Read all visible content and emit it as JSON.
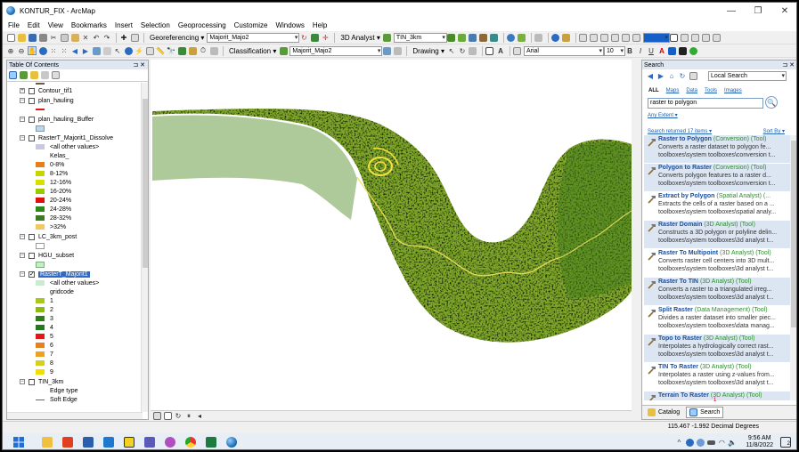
{
  "window": {
    "title": "KONTUR_FIX - ArcMap",
    "min": "—",
    "max": "❐",
    "close": "✕"
  },
  "menu": [
    "File",
    "Edit",
    "View",
    "Bookmarks",
    "Insert",
    "Selection",
    "Geoprocessing",
    "Customize",
    "Windows",
    "Help"
  ],
  "toolbar1": {
    "georef_label": "Georeferencing ▾",
    "georef_layer": "Majorit_Majo2",
    "analyst_label": "3D Analyst ▾",
    "analyst_layer": "TIN_3km",
    "fill_color": "#1560c8"
  },
  "toolbar2": {
    "classification_label": "Classification ▾",
    "classification_layer": "Majorit_Majo2",
    "drawing_label": "Drawing ▾",
    "font": "Arial",
    "font_size": "10",
    "bold": "B",
    "italic": "I",
    "underline": "U"
  },
  "toc": {
    "title": "Table Of Contents",
    "pin": "⊐ ✕",
    "items": [
      {
        "label": "Contour_tif1",
        "checked": false
      },
      {
        "label": "plan_hauling",
        "checked": false
      },
      {
        "label": "plan_hauling_Buffer",
        "checked": false
      },
      {
        "label": "RasterT_Majorit1_Dissolve",
        "checked": false
      },
      {
        "label": "<all other values>"
      },
      {
        "label": "Kelas_"
      },
      {
        "label": "0-8%",
        "color": "#e87d1e"
      },
      {
        "label": "8-12%",
        "color": "#c8d400"
      },
      {
        "label": "12-16%",
        "color": "#d8e000"
      },
      {
        "label": "16-20%",
        "color": "#9cc800"
      },
      {
        "label": "20-24%",
        "color": "#e01010"
      },
      {
        "label": "24-28%",
        "color": "#2a8a1a"
      },
      {
        "label": "28-32%",
        "color": "#3c7a24"
      },
      {
        "label": ">32%",
        "color": "#f2c860"
      },
      {
        "label": "LC_3km_post",
        "checked": false
      },
      {
        "label": "HGU_subset",
        "checked": false
      },
      {
        "label": "RasterT_Majorit1",
        "checked": true
      },
      {
        "label": "<all other values>"
      },
      {
        "label": "gridcode"
      },
      {
        "label": "1",
        "color": "#a8c820"
      },
      {
        "label": "2",
        "color": "#8cbc14"
      },
      {
        "label": "3",
        "color": "#2e7c1e"
      },
      {
        "label": "4",
        "color": "#237a1c"
      },
      {
        "label": "5",
        "color": "#e01818"
      },
      {
        "label": "6",
        "color": "#e88020"
      },
      {
        "label": "7",
        "color": "#f0a020"
      },
      {
        "label": "8",
        "color": "#d4d020"
      },
      {
        "label": "9",
        "color": "#f0e000"
      },
      {
        "label": "TIN_3km",
        "checked": false
      },
      {
        "label": "Edge type"
      },
      {
        "label": "Soft Edge"
      }
    ]
  },
  "search": {
    "title": "Search",
    "pin": "⊐ ✕",
    "mode": "Local Search",
    "filters": [
      "ALL",
      "Maps",
      "Data",
      "Tools",
      "Images"
    ],
    "query": "raster to polygon",
    "extent": "Any Extent ▾",
    "returned": "Search returned 17 items ▾",
    "sort": "Sort By ▾",
    "results": [
      {
        "name": "Raster to Polygon",
        "toolbox": "(Conversion)",
        "kind": "(Tool)",
        "desc": "Converts a raster dataset to polygon fe...",
        "path": "toolboxes\\system toolboxes\\conversion t..."
      },
      {
        "name": "Polygon to Raster",
        "toolbox": "(Conversion)",
        "kind": "(Tool)",
        "desc": "Converts polygon features to a raster d...",
        "path": "toolboxes\\system toolboxes\\conversion t..."
      },
      {
        "name": "Extract by Polygon",
        "toolbox": "(Spatial Analyst)",
        "kind": "(...",
        "desc": "Extracts the cells of a raster based on a ...",
        "path": "toolboxes\\system toolboxes\\spatial analy..."
      },
      {
        "name": "Raster Domain",
        "toolbox": "(3D Analyst)",
        "kind": "(Tool)",
        "desc": "Constructs a 3D polygon or polyline delin...",
        "path": "toolboxes\\system toolboxes\\3d analyst t..."
      },
      {
        "name": "Raster To Multipoint",
        "toolbox": "(3D Analyst)",
        "kind": "(Tool)",
        "desc": "Converts raster cell centers into 3D mult...",
        "path": "toolboxes\\system toolboxes\\3d analyst t..."
      },
      {
        "name": "Raster To TIN",
        "toolbox": "(3D Analyst)",
        "kind": "(Tool)",
        "desc": "Converts a raster to a triangulated irreg...",
        "path": "toolboxes\\system toolboxes\\3d analyst t..."
      },
      {
        "name": "Split Raster",
        "toolbox": "(Data Management)",
        "kind": "(Tool)",
        "desc": "Divides a raster dataset into smaller piec...",
        "path": "toolboxes\\system toolboxes\\data manag..."
      },
      {
        "name": "Topo to Raster",
        "toolbox": "(3D Analyst)",
        "kind": "(Tool)",
        "desc": "Interpolates a hydrologically correct rast...",
        "path": "toolboxes\\system toolboxes\\3d analyst t..."
      },
      {
        "name": "TIN To Raster",
        "toolbox": "(3D Analyst)",
        "kind": "(Tool)",
        "desc": "Interpolates a raster using z-values from...",
        "path": "toolboxes\\system toolboxes\\3d analyst t..."
      },
      {
        "name": "Terrain To Raster",
        "toolbox": "(3D Analyst)",
        "kind": "(Tool)",
        "desc": "",
        "path": ""
      }
    ],
    "tabs": [
      "Catalog",
      "Search"
    ],
    "badge": "1"
  },
  "status": {
    "coords": "115.467  -1.992 Decimal Degrees"
  },
  "taskbar": {
    "time": "9:56 AM",
    "date": "11/8/2022",
    "notif_count": "2",
    "tray_caret": "^"
  }
}
